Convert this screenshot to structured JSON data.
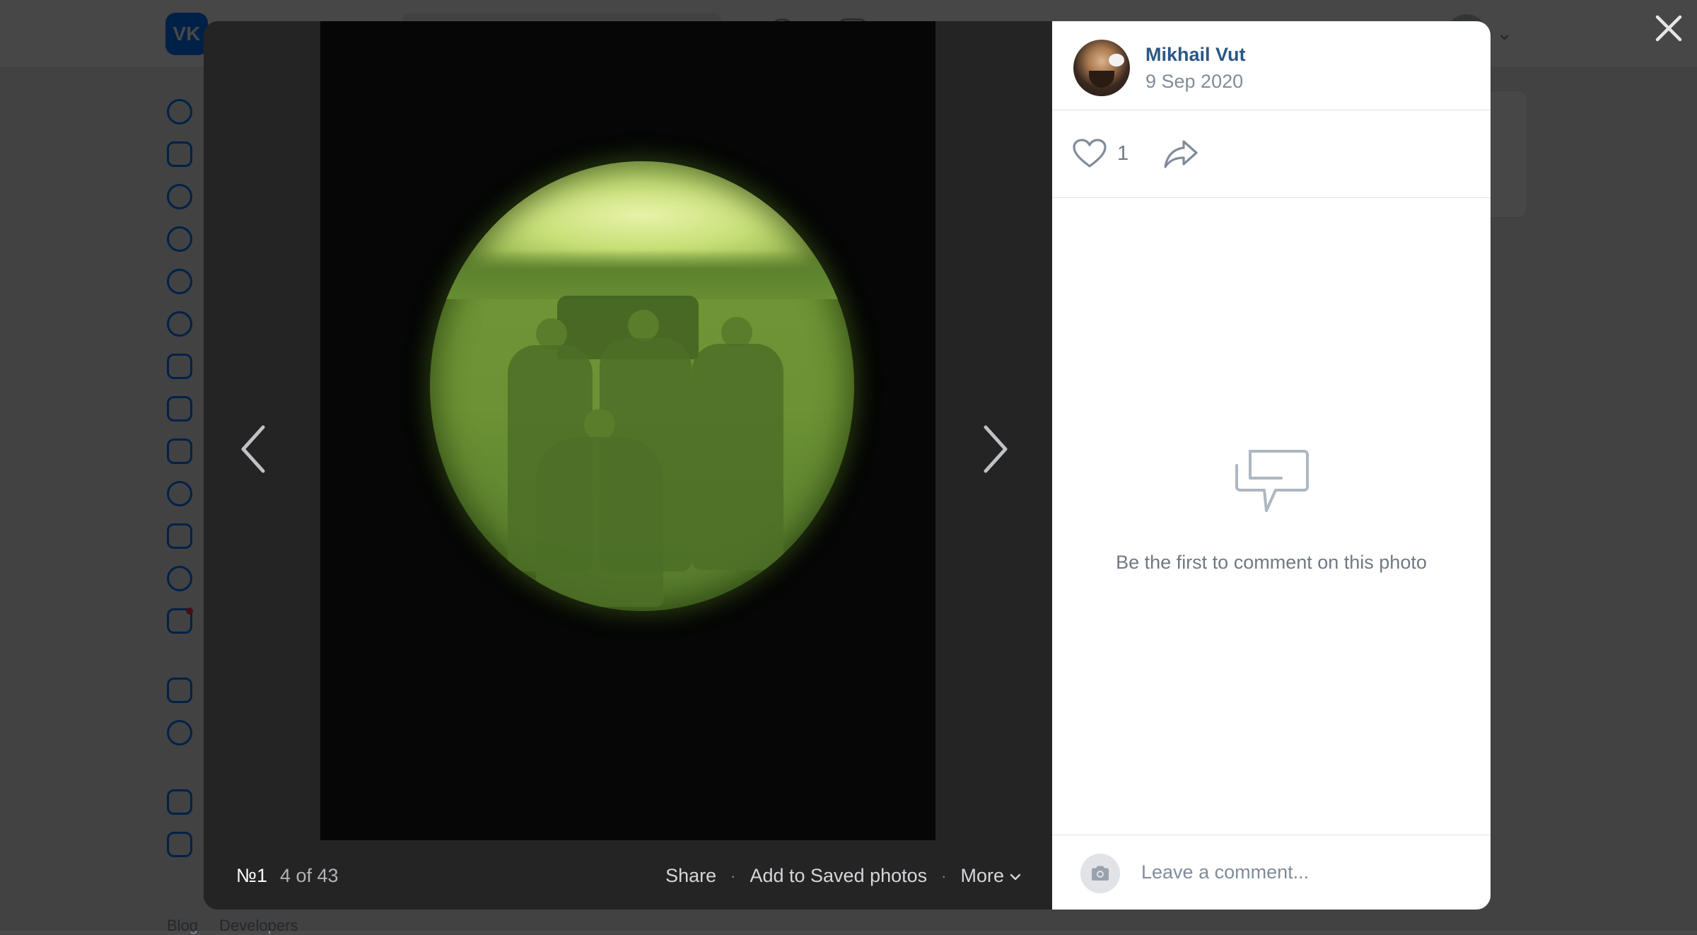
{
  "background": {
    "logo_text": "VK",
    "footer_links": [
      "Blog",
      "Developers"
    ]
  },
  "viewer": {
    "photo_number": "№1",
    "photo_counter": "4 of 43",
    "actions": {
      "share": "Share",
      "save": "Add to Saved photos",
      "more": "More"
    }
  },
  "side_panel": {
    "author_name": "Mikhail Vut",
    "date": "9 Sep 2020",
    "like_count": "1",
    "empty_comments_text": "Be the first to comment on this photo",
    "comment_placeholder": "Leave a comment..."
  },
  "colors": {
    "link": "#2a5885",
    "accent": "#0077ff",
    "muted": "#818c99"
  }
}
